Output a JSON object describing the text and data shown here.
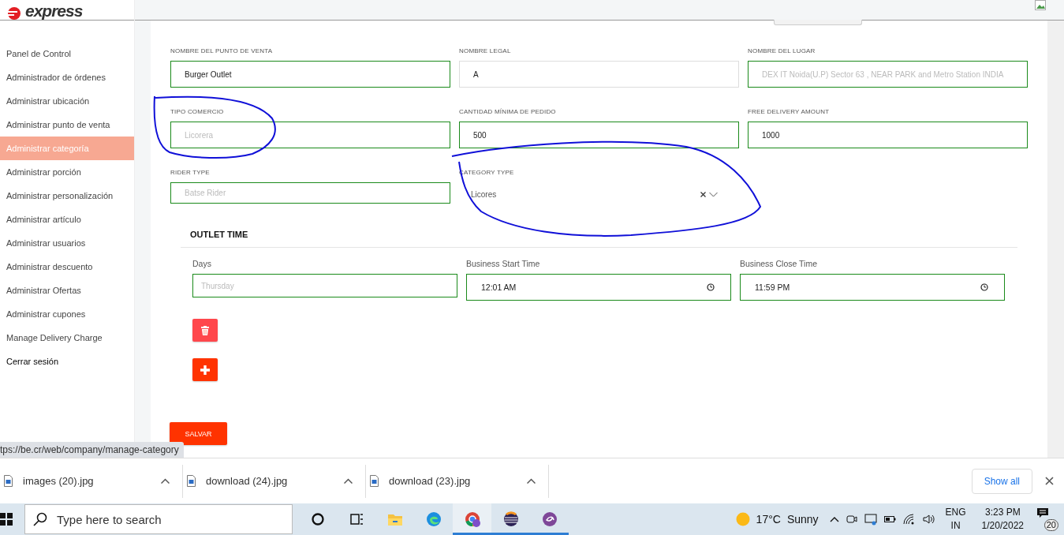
{
  "logo": {
    "text": "express"
  },
  "sidebar": {
    "items": [
      {
        "label": "Panel de Control",
        "selected": false
      },
      {
        "label": "Administrador de órdenes",
        "selected": false
      },
      {
        "label": "Administrar ubicación",
        "selected": false
      },
      {
        "label": "Administrar punto de venta",
        "selected": false
      },
      {
        "label": "Administrar categoría",
        "selected": true
      },
      {
        "label": "Administrar porción",
        "selected": false
      },
      {
        "label": "Administrar personalización",
        "selected": false
      },
      {
        "label": "Administrar artículo",
        "selected": false
      },
      {
        "label": "Administrar usuarios",
        "selected": false
      },
      {
        "label": "Administrar descuento",
        "selected": false
      },
      {
        "label": "Administrar Ofertas",
        "selected": false
      },
      {
        "label": "Administrar cupones",
        "selected": false
      },
      {
        "label": "Manage Delivery Charge",
        "selected": false
      },
      {
        "label": "Cerrar sesión",
        "selected": false
      }
    ]
  },
  "form": {
    "fields": [
      {
        "kind": "text",
        "label": "NOMBRE DEL PUNTO DE VENTA",
        "value": "Burger Outlet",
        "valid": true
      },
      {
        "kind": "text",
        "label": "NOMBRE LEGAL",
        "value": "A",
        "valid": false
      },
      {
        "kind": "text",
        "label": "NOMBRE DEL LUGAR",
        "placeholder": "DEX IT Noida(U.P) Sector 63 , NEAR PARK and Metro Station INDIA",
        "valid": true
      },
      {
        "kind": "text",
        "label": "TIPO COMERCIO",
        "placeholder": "Licorera",
        "valid": true
      },
      {
        "kind": "text",
        "label": "CANTIDAD MÍNIMA DE PEDIDO",
        "value": "500",
        "valid": true
      },
      {
        "kind": "text",
        "label": "FREE DELIVERY AMOUNT",
        "value": "1000",
        "valid": true
      },
      {
        "kind": "text",
        "label": "RIDER TYPE",
        "placeholder": "Batse Rider",
        "valid": true
      },
      {
        "kind": "select",
        "label": "CATEGORY TYPE",
        "value": "Licores",
        "valid": false
      }
    ]
  },
  "outlet_time": {
    "title": "OUTLET TIME",
    "fields": [
      {
        "kind": "text",
        "label": "Days",
        "placeholder": "Thursday"
      },
      {
        "kind": "time",
        "label": "Business Start Time",
        "value": "12:01 AM"
      },
      {
        "kind": "time",
        "label": "Business Close Time",
        "value": "11:59 PM"
      }
    ]
  },
  "save_button": "SALVAR",
  "status_url": "tps://be.cr/web/company/manage-category",
  "downloads": {
    "items": [
      {
        "name": "images (20).jpg"
      },
      {
        "name": "download (24).jpg"
      },
      {
        "name": "download (23).jpg"
      }
    ],
    "show_all": "Show all"
  },
  "taskbar": {
    "search_placeholder": "Type here to search",
    "apps": [
      {
        "kind": "cortana",
        "running": false,
        "selected": false
      },
      {
        "kind": "taskview",
        "running": false,
        "selected": false
      },
      {
        "kind": "explorer",
        "running": false,
        "selected": false
      },
      {
        "kind": "edge",
        "running": false,
        "selected": false
      },
      {
        "kind": "chrome",
        "running": true,
        "selected": true
      },
      {
        "kind": "eclipse",
        "running": true,
        "selected": false
      },
      {
        "kind": "tor",
        "running": true,
        "selected": false
      }
    ],
    "weather": {
      "temperature": "17°C",
      "condition": "Sunny"
    },
    "language": {
      "line1": "ENG",
      "line2": "IN"
    },
    "time": "3:23 PM",
    "date": "1/20/2022",
    "notifications": "20"
  }
}
